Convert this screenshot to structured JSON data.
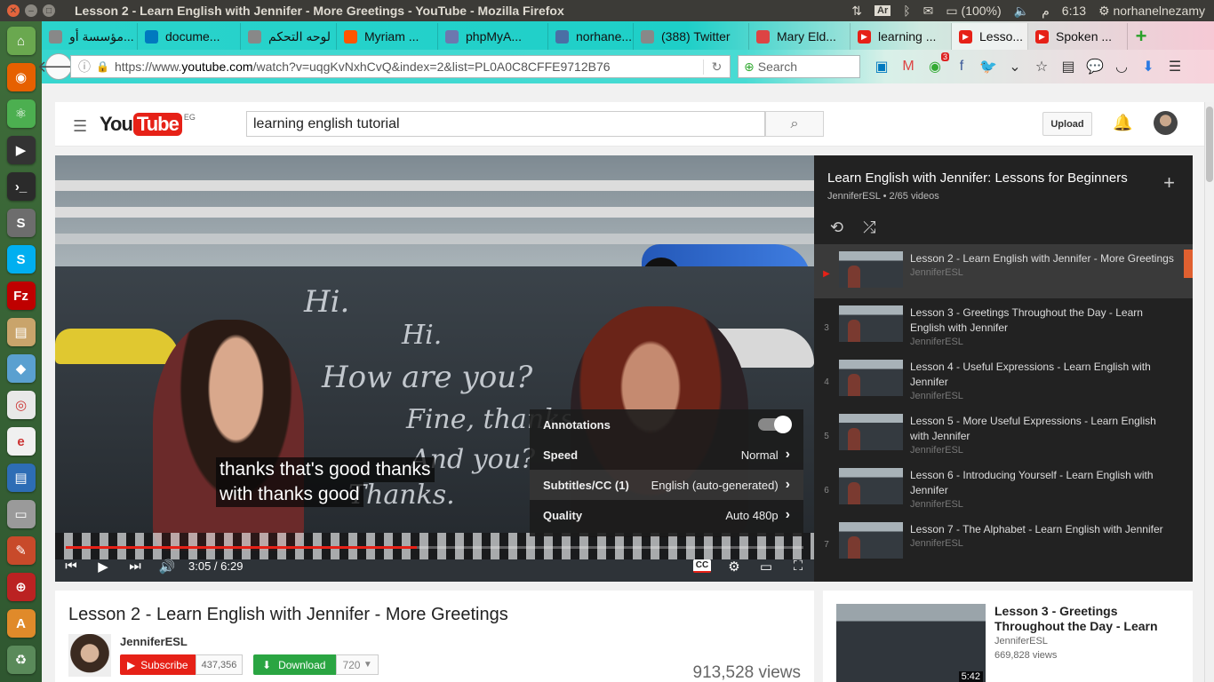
{
  "window": {
    "title": "Lesson 2 - Learn English with Jennifer - More Greetings - YouTube - Mozilla Firefox",
    "battery": "(100%)",
    "clock": "6:13",
    "clock_suffix": "م",
    "user": "norhanelnezamy",
    "keyboard": "Ar"
  },
  "launcher": {
    "icons": [
      "home-icon",
      "firefox-icon",
      "atom-icon",
      "video-editor-icon",
      "terminal-icon",
      "sublime-icon",
      "skype-icon",
      "filezilla-icon",
      "files-icon",
      "virtualbox-icon",
      "chrome-icon",
      "eclipse-icon",
      "writer-icon",
      "drive-icon",
      "settings-icon",
      "remote-icon",
      "software-center-icon",
      "recycle-icon"
    ]
  },
  "tabs": [
    {
      "label": "مؤسسة أو...",
      "icon": "generic-tab-icon"
    },
    {
      "label": "docume...",
      "icon": "trello-icon"
    },
    {
      "label": "لوحه التحكم",
      "icon": "generic-tab-icon"
    },
    {
      "label": "Myriam ...",
      "icon": "soundcloud-icon"
    },
    {
      "label": "phpMyA...",
      "icon": "phpmyadmin-icon"
    },
    {
      "label": "norhane...",
      "icon": "shield-icon"
    },
    {
      "label": "(388) Twitter",
      "icon": "generic-tab-icon"
    },
    {
      "label": "Mary Eld...",
      "icon": "gmail-icon"
    },
    {
      "label": "learning ...",
      "icon": "youtube-icon"
    },
    {
      "label": "Lesso...",
      "icon": "youtube-icon",
      "active": true
    },
    {
      "label": "Spoken ...",
      "icon": "youtube-icon"
    }
  ],
  "nav": {
    "url_prefix": "https://www.",
    "url_domain": "youtube.com",
    "url_rest": "/watch?v=uqgKvNxhCvQ&index=2&list=PL0A0C8CFFE9712B76",
    "search_placeholder": "Search",
    "notification_badge": "3"
  },
  "youtube": {
    "region": "EG",
    "search_value": "learning english tutorial",
    "upload_label": "Upload"
  },
  "player": {
    "subtitle_line1": "thanks that's good thanks",
    "subtitle_line2": "with thanks good",
    "time": "3:05 / 6:29",
    "progress": 0.476,
    "chalk": [
      "Hi.",
      "Hi.",
      "How are you?",
      "Fine, thanks.",
      "And you?",
      "Thanks."
    ],
    "settings": {
      "annotations_label": "Annotations",
      "annotations_on": true,
      "speed_label": "Speed",
      "speed_value": "Normal",
      "subtitles_label": "Subtitles/CC (1)",
      "subtitles_value": "English (auto-generated)",
      "quality_label": "Quality",
      "quality_value": "Auto 480p"
    },
    "cc_label": "CC"
  },
  "playlist": {
    "title": "Learn English with Jennifer: Lessons for Beginners",
    "subtitle": "JenniferESL • 2/65 videos",
    "items": [
      {
        "num": "▶",
        "title": "Lesson 2 - Learn English with Jennifer - More Greetings",
        "channel": "JenniferESL",
        "current": true
      },
      {
        "num": "3",
        "title": "Lesson 3 - Greetings Throughout the Day - Learn English with Jennifer",
        "channel": "JenniferESL"
      },
      {
        "num": "4",
        "title": "Lesson 4 - Useful Expressions - Learn English with Jennifer",
        "channel": "JenniferESL"
      },
      {
        "num": "5",
        "title": "Lesson 5 - More Useful Expressions - Learn English with Jennifer",
        "channel": "JenniferESL"
      },
      {
        "num": "6",
        "title": "Lesson 6 - Introducing Yourself - Learn English with Jennifer",
        "channel": "JenniferESL"
      },
      {
        "num": "7",
        "title": "Lesson 7 - The Alphabet - Learn English with Jennifer",
        "channel": "JenniferESL"
      }
    ]
  },
  "video": {
    "title": "Lesson 2 - Learn English with Jennifer - More Greetings",
    "channel": "JenniferESL",
    "subscribe_label": "Subscribe",
    "subscribers": "437,356",
    "download_label": "Download",
    "download_quality": "720",
    "views": "913,528 views"
  },
  "up_next": {
    "title": "Lesson 3 - Greetings Throughout the Day - Learn",
    "channel": "JenniferESL",
    "views": "669,828 views",
    "duration": "5:42"
  }
}
